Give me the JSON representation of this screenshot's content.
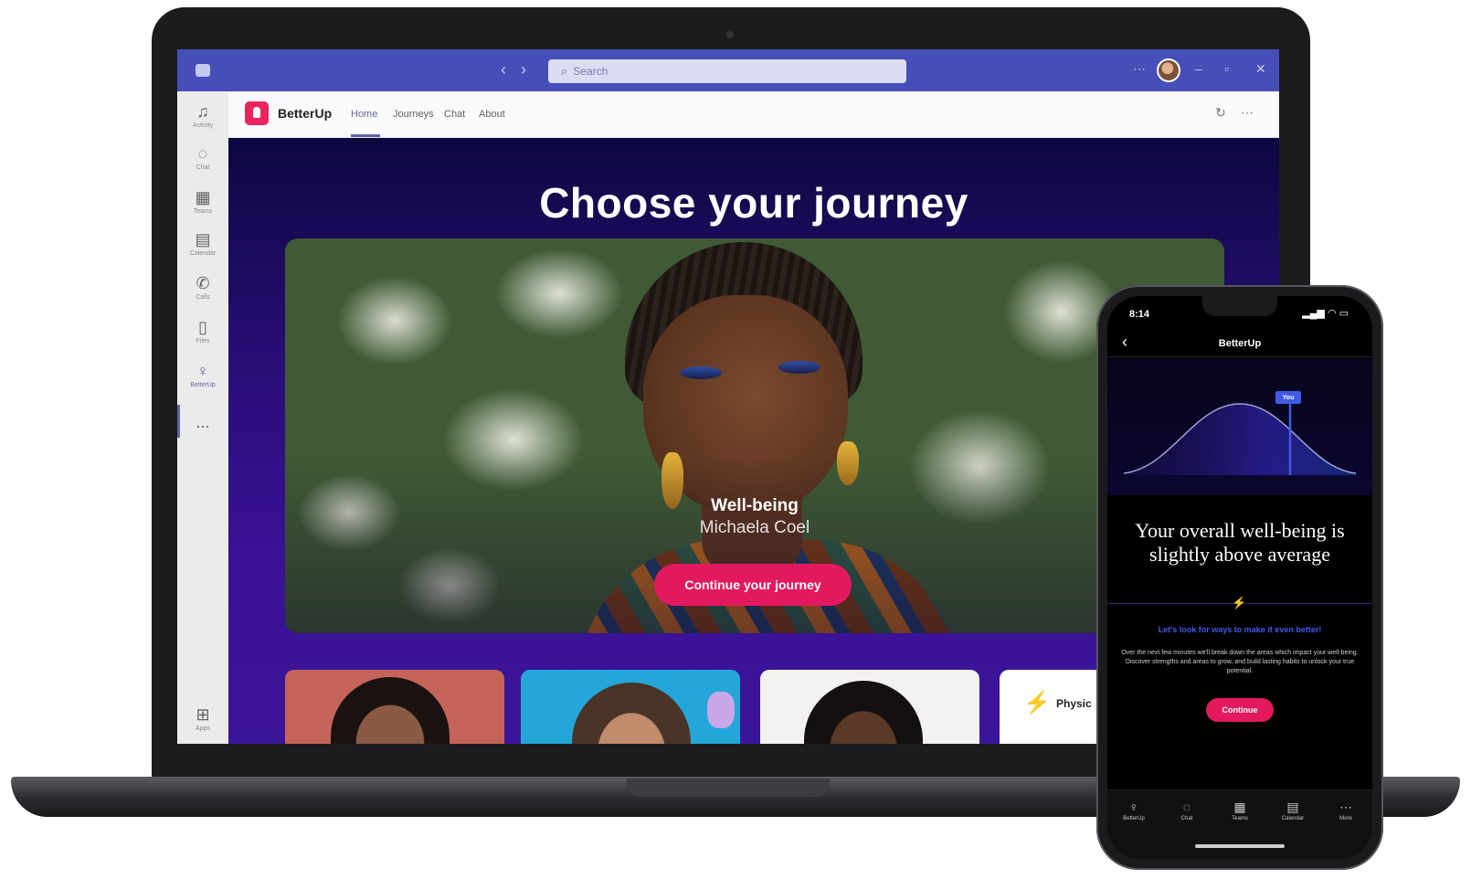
{
  "teams": {
    "search_placeholder": "Search",
    "rail": [
      {
        "label": "Activity",
        "icon": "bell-icon"
      },
      {
        "label": "Chat",
        "icon": "chat-icon"
      },
      {
        "label": "Teams",
        "icon": "teams-icon"
      },
      {
        "label": "Calendar",
        "icon": "calendar-icon"
      },
      {
        "label": "Calls",
        "icon": "phone-icon"
      },
      {
        "label": "Files",
        "icon": "file-icon"
      },
      {
        "label": "BetterUp",
        "icon": "betterup-icon"
      },
      {
        "label": "Apps",
        "icon": "apps-icon"
      }
    ],
    "more_label": "...",
    "app": {
      "name": "BetterUp",
      "tabs": [
        "Home",
        "Journeys",
        "Chat",
        "About"
      ]
    }
  },
  "content": {
    "headline": "Choose your journey",
    "hero": {
      "title": "Well-being",
      "subtitle": "Michaela Coel",
      "cta": "Continue your journey"
    },
    "cards": [
      {
        "text": ""
      },
      {
        "text": ""
      },
      {
        "text": ""
      },
      {
        "text": "Physic"
      }
    ]
  },
  "phone": {
    "time": "8:14",
    "status": "▂▄▆ ◠ ▭",
    "title": "BetterUp",
    "badge": "You",
    "headline": "Your overall well-being is slightly above average",
    "link": "Let's look for ways to make it even better!",
    "body": "Over the next few minutes we'll break down the areas which impact your well-being. Discover strengths and areas to grow, and build lasting habits to unlock your true potential.",
    "cta": "Continue",
    "nav": [
      "BetterUp",
      "Chat",
      "Teams",
      "Calendar",
      "More"
    ]
  },
  "colors": {
    "teams_bar": "#464eb8",
    "accent": "#6264a7",
    "brand_pink": "#e2195f",
    "content_purple": "#3a1196",
    "phone_blue": "#3f5be8"
  }
}
